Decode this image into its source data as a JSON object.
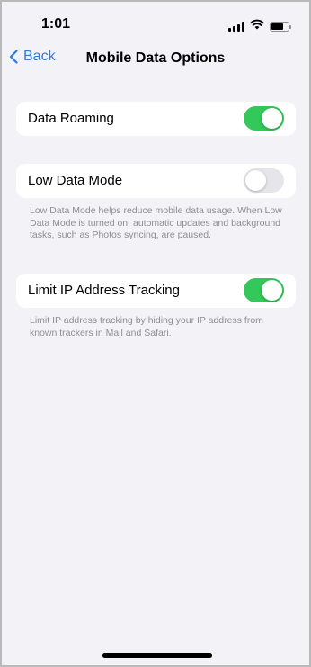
{
  "status_bar": {
    "time": "1:01",
    "icons": [
      "cellular-signal-icon",
      "wifi-icon",
      "battery-icon"
    ]
  },
  "nav": {
    "back_label": "Back",
    "title": "Mobile Data Options"
  },
  "settings": [
    {
      "label": "Data Roaming",
      "enabled": true,
      "footnote": ""
    },
    {
      "label": "Low Data Mode",
      "enabled": false,
      "footnote": "Low Data Mode helps reduce mobile data usage. When Low Data Mode is turned on, automatic updates and background tasks, such as Photos syncing, are paused."
    },
    {
      "label": "Limit IP Address Tracking",
      "enabled": true,
      "footnote": "Limit IP address tracking by hiding your IP address from known trackers in Mail and Safari."
    }
  ],
  "colors": {
    "accent": "#2f7cd8",
    "toggle_on": "#34c759",
    "toggle_off": "#e5e5ea",
    "background": "#f2f2f7"
  }
}
